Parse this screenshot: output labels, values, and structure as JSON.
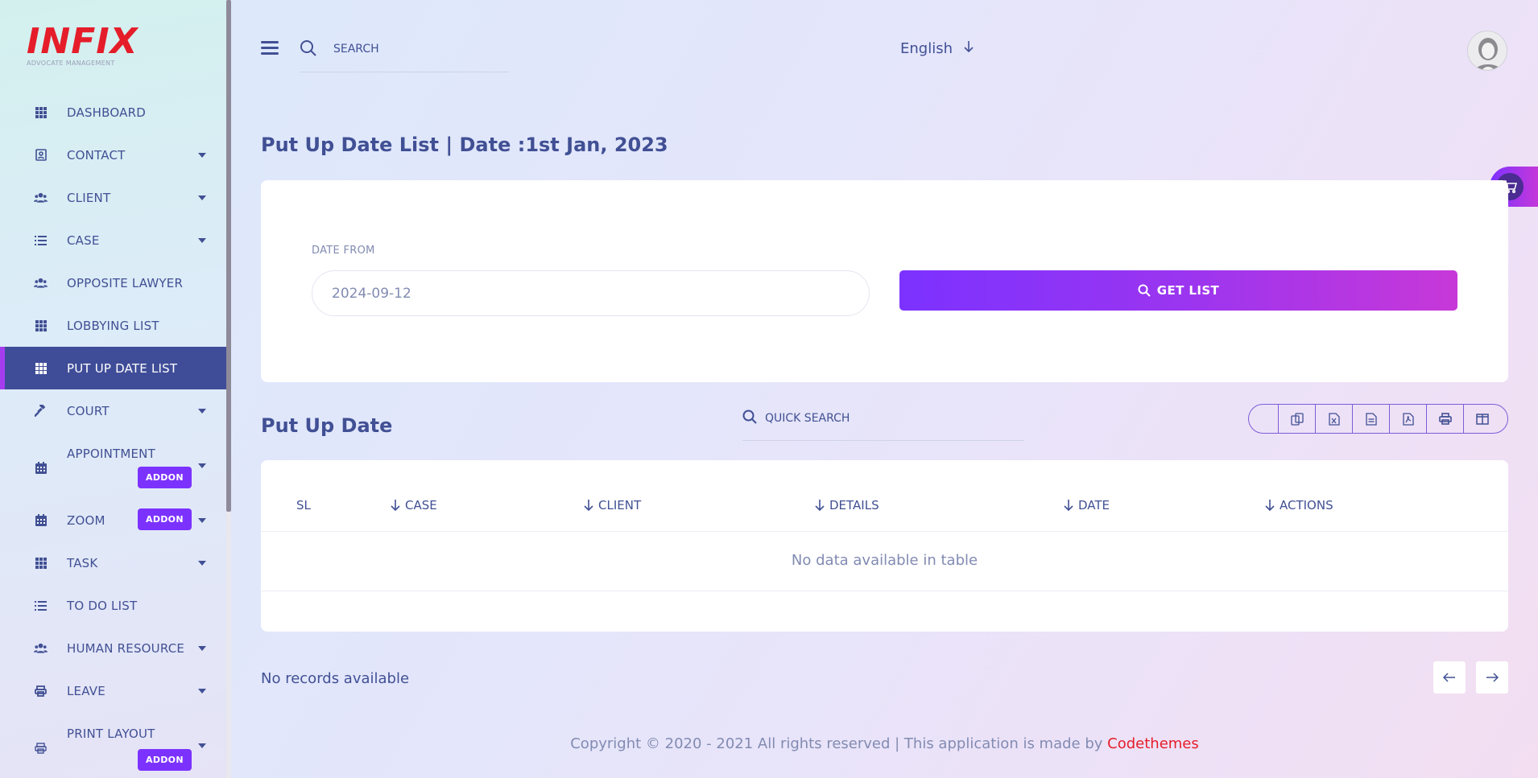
{
  "colors": {
    "primary": "#415094",
    "accent_purple": "#7c32ff",
    "accent_pink": "#c738d8",
    "logo_red": "#e51d2a",
    "muted": "#828bb2",
    "active_bg": "#3f4d98"
  },
  "brand": {
    "logo_text": "INFIX",
    "logo_subtitle": "ADVOCATE MANAGEMENT"
  },
  "sidebar": {
    "items": [
      {
        "label": "Dashboard",
        "icon": "grid-icon"
      },
      {
        "label": "Contact",
        "icon": "contact-book-icon"
      },
      {
        "label": "Client",
        "icon": "users-icon"
      },
      {
        "label": "Case",
        "icon": "list-icon"
      },
      {
        "label": "Opposite Lawyer",
        "icon": "users-icon"
      },
      {
        "label": "Lobbying List",
        "icon": "grid-icon"
      },
      {
        "label": "Put Up Date List",
        "icon": "grid-icon"
      },
      {
        "label": "Court",
        "icon": "gavel-icon"
      },
      {
        "label": "Appointment",
        "icon": "calendar-icon",
        "badge": "ADDON"
      },
      {
        "label": "Zoom",
        "icon": "calendar-icon",
        "badge": "ADDON"
      },
      {
        "label": "Task",
        "icon": "grid-icon"
      },
      {
        "label": "To Do List",
        "icon": "list-icon"
      },
      {
        "label": "Human Resource",
        "icon": "users-icon"
      },
      {
        "label": "Leave",
        "icon": "printer-icon"
      },
      {
        "label": "Print Layout",
        "icon": "printer-icon",
        "badge": "ADDON"
      }
    ]
  },
  "header": {
    "search_placeholder": "SEARCH",
    "language": "English"
  },
  "page": {
    "title": "Put Up Date List | Date :1st Jan, 2023",
    "filter": {
      "date_from_label": "DATE FROM",
      "date_from_value": "2024-09-12",
      "get_list_label": "GET LIST"
    },
    "section_title": "Put Up Date",
    "quick_search_placeholder": "QUICK SEARCH",
    "export_buttons": [
      "copy-icon",
      "excel-icon",
      "csv-icon",
      "pdf-icon",
      "print-icon",
      "columns-icon"
    ],
    "table": {
      "columns": [
        "SL",
        "Case",
        "Client",
        "Details",
        "Date",
        "Actions"
      ],
      "empty_message": "No data available in table"
    },
    "records_text": "No records available"
  },
  "footer": {
    "text": "Copyright © 2020 - 2021 All rights reserved | This application is made by ",
    "link_text": "Codethemes"
  }
}
